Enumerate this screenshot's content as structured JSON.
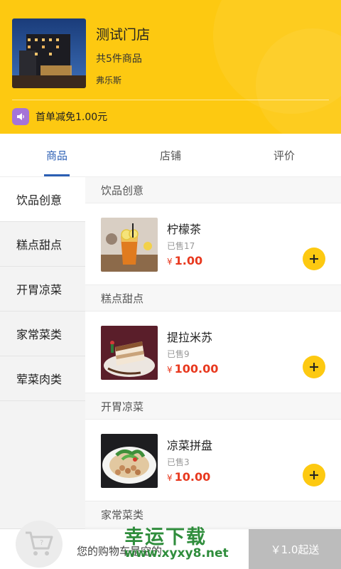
{
  "store": {
    "name": "测试门店",
    "count": "共5件商品",
    "city": "弗乐斯",
    "promo": "首单减免1.00元"
  },
  "tabs": [
    {
      "label": "商品",
      "active": true
    },
    {
      "label": "店铺",
      "active": false
    },
    {
      "label": "评价",
      "active": false
    }
  ],
  "categories": [
    {
      "label": "饮品创意",
      "active": true
    },
    {
      "label": "糕点甜点",
      "active": false
    },
    {
      "label": "开胃凉菜",
      "active": false
    },
    {
      "label": "家常菜类",
      "active": false
    },
    {
      "label": "荤菜肉类",
      "active": false
    }
  ],
  "sections": [
    {
      "title": "饮品创意",
      "product": {
        "name": "柠檬茶",
        "sold": "已售17",
        "currency": "¥",
        "price": "1.00",
        "image": "lemon-tea"
      }
    },
    {
      "title": "糕点甜点",
      "product": {
        "name": "提拉米苏",
        "sold": "已售9",
        "currency": "¥",
        "price": "100.00",
        "image": "tiramisu"
      }
    },
    {
      "title": "开胃凉菜",
      "product": {
        "name": "凉菜拼盘",
        "sold": "已售3",
        "currency": "¥",
        "price": "10.00",
        "image": "cold-dish"
      }
    },
    {
      "title": "家常菜类"
    }
  ],
  "cart": {
    "empty_text": "您的购物车是空的",
    "checkout_label": "￥1.0起送"
  },
  "watermark": {
    "line1": "幸运下载",
    "line2": "www.xyxy8.net"
  },
  "colors": {
    "brand_yellow": "#fdc911",
    "tab_active": "#2b5fb4",
    "price_red": "#e8391f",
    "promo_purple": "#a574d8"
  }
}
